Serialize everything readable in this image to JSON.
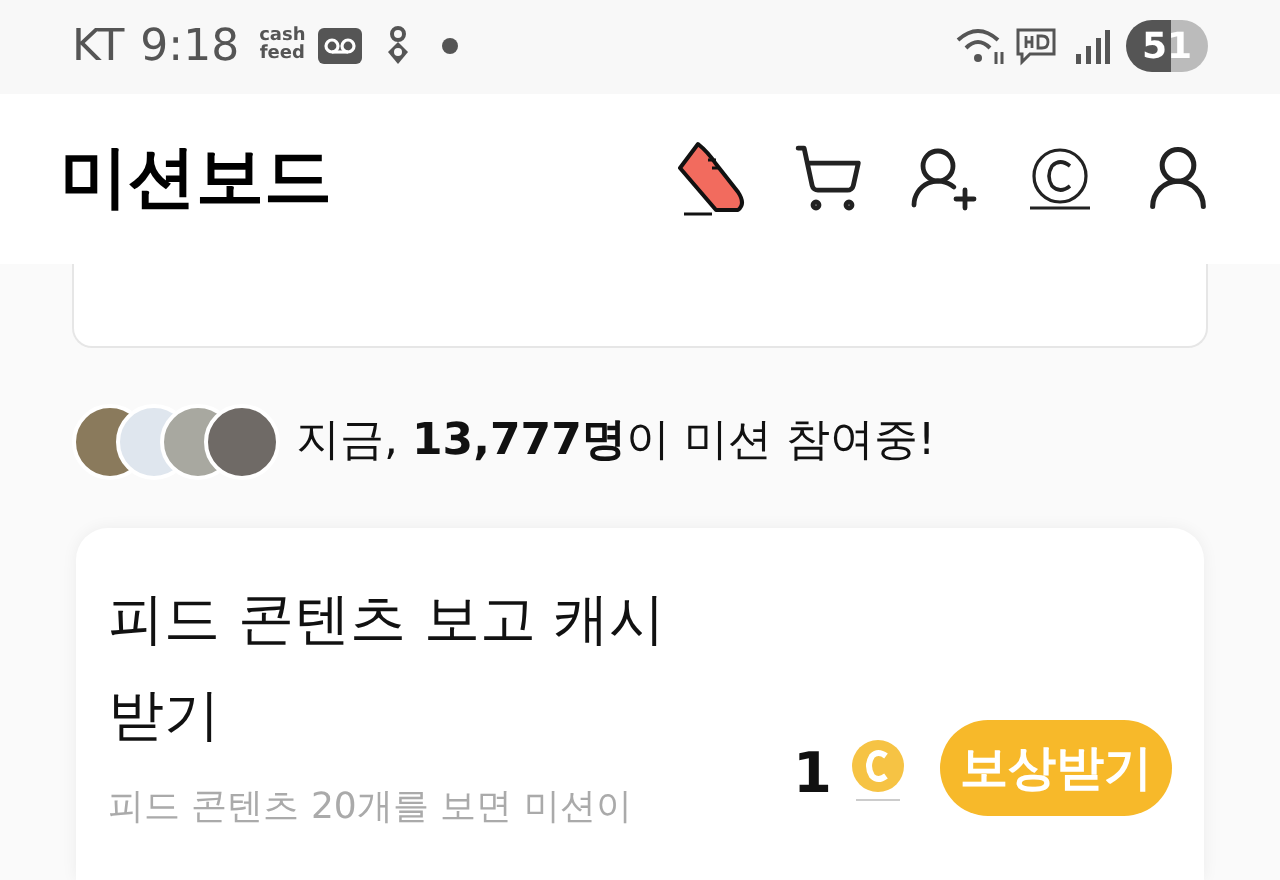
{
  "status_bar": {
    "carrier": "KT",
    "time": "9:18",
    "app_logo": [
      "cash",
      "feed"
    ],
    "battery": "51"
  },
  "header": {
    "title": "미션보드"
  },
  "participants": {
    "avatars": [
      {
        "color": "#8a7a5c"
      },
      {
        "color": "#dfe6ee"
      },
      {
        "color": "#a8a8a0"
      },
      {
        "color": "#6f6a66"
      }
    ],
    "text": "지금, **13,777명**이 미션 참여중!"
  },
  "missions": [
    {
      "title": "피드 콘텐츠 보고 캐시 받기",
      "description": "피드 콘텐츠 20개를 보면 미션이",
      "reward": "1",
      "button": "보상받기"
    }
  ]
}
